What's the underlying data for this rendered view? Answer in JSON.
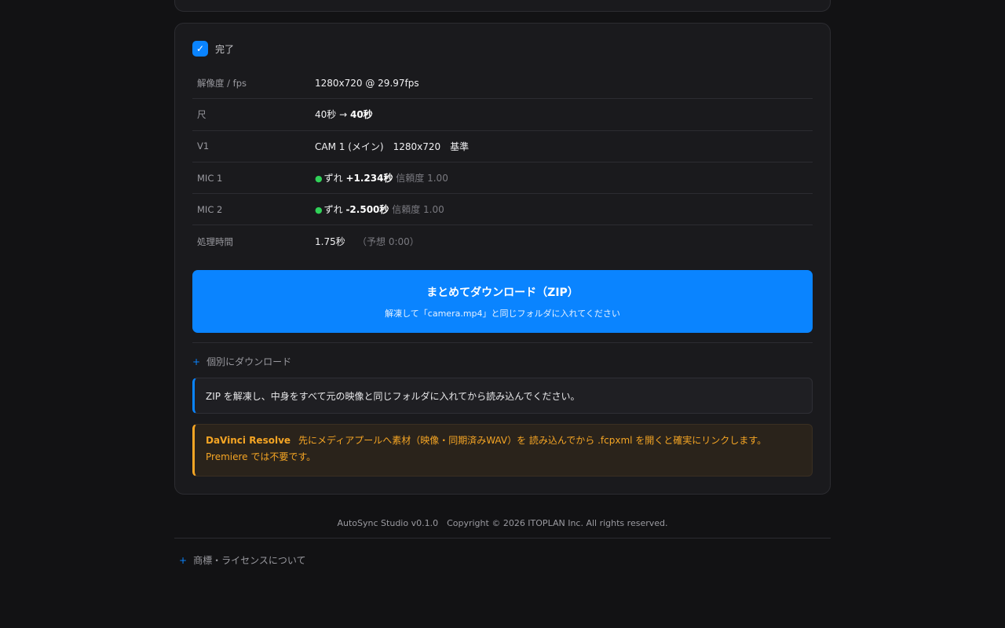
{
  "status": {
    "done_label": "完了",
    "check_icon": "✓"
  },
  "rows": {
    "resolution": {
      "key": "解像度 / fps",
      "value": "1280x720 @ 29.97fps"
    },
    "length": {
      "key": "尺",
      "from": "40秒",
      "arrow": " → ",
      "to": "40秒"
    },
    "v1": {
      "key": "V1",
      "value": "CAM 1 (メイン)　1280x720　基準"
    },
    "mic1": {
      "key": "MIC 1",
      "offset_label": "ずれ",
      "offset": "+1.234秒",
      "confidence": "信頼度 1.00"
    },
    "mic2": {
      "key": "MIC 2",
      "offset_label": "ずれ",
      "offset": "-2.500秒",
      "confidence": "信頼度 1.00"
    },
    "processing": {
      "key": "処理時間",
      "value": "1.75秒",
      "estimate": "（予想 0:00）"
    }
  },
  "download": {
    "title": "まとめてダウンロード（ZIP）",
    "subtitle": "解凍して「camera.mp4」と同じフォルダに入れてください"
  },
  "individual": {
    "plus": "+",
    "label": "個別にダウンロード"
  },
  "info_note": "ZIP を解凍し、中身をすべて元の映像と同じフォルダに入れてから読み込んでください。",
  "warning": {
    "title": "DaVinci Resolve",
    "text": "先にメディアプールへ素材（映像・同期済みWAV）を 読み込んでから .fcpxml を開くと確実にリンクします。Premiere では不要です。"
  },
  "footer": {
    "copyright": "AutoSync Studio v0.1.0　Copyright © 2026 ITOPLAN Inc. All rights reserved.",
    "plus": "+",
    "license_label": "商標・ライセンスについて"
  },
  "colors": {
    "accent": "#0a84ff",
    "success": "#30d158",
    "warning": "#f5a524",
    "background": "#121214",
    "card": "#1a1a1d"
  }
}
